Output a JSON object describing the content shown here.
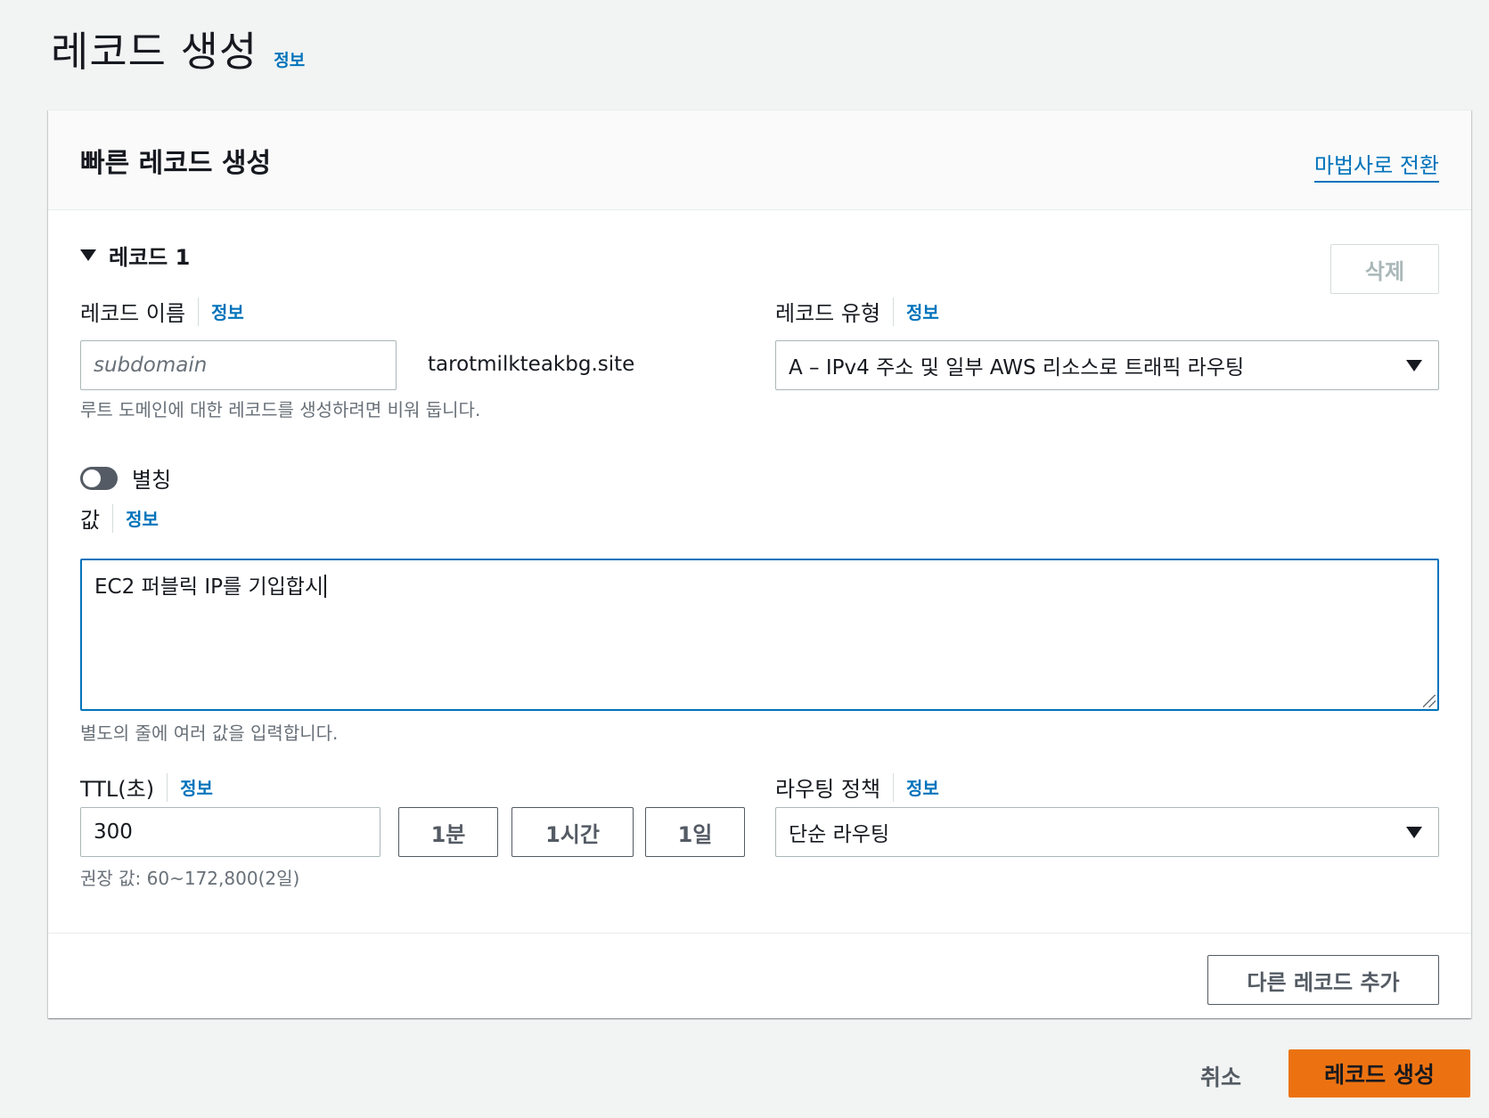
{
  "page": {
    "title": "레코드 생성",
    "info_link": "정보"
  },
  "quick_create": {
    "title": "빠른 레코드 생성",
    "wizard_link": "마법사로 전환"
  },
  "record": {
    "title": "레코드 1",
    "delete_label": "삭제",
    "name": {
      "label": "레코드 이름",
      "info": "정보",
      "placeholder": "subdomain",
      "value": "",
      "domain_suffix": "tarotmilkteakbg.site",
      "hint": "루트 도메인에 대한 레코드를 생성하려면 비워 둡니다."
    },
    "type": {
      "label": "레코드 유형",
      "info": "정보",
      "selected": "A – IPv4 주소 및 일부 AWS 리소스로 트래픽 라우팅"
    },
    "alias": {
      "label": "별칭",
      "enabled": false
    },
    "value": {
      "label": "값",
      "info": "정보",
      "text": "EC2 퍼블릭 IP를 기입합시",
      "hint": "별도의 줄에 여러 값을 입력합니다."
    },
    "ttl": {
      "label": "TTL(초)",
      "info": "정보",
      "value": "300",
      "buttons": [
        "1분",
        "1시간",
        "1일"
      ],
      "hint": "권장 값: 60~172,800(2일)"
    },
    "routing": {
      "label": "라우팅 정책",
      "info": "정보",
      "selected": "단순 라우팅"
    }
  },
  "add_record_label": "다른 레코드 추가",
  "footer": {
    "cancel_label": "취소",
    "create_label": "레코드 생성"
  },
  "colors": {
    "primary": "#ec7211",
    "link": "#0073bb",
    "focus": "#0073bb",
    "background": "#f2f3f3"
  }
}
